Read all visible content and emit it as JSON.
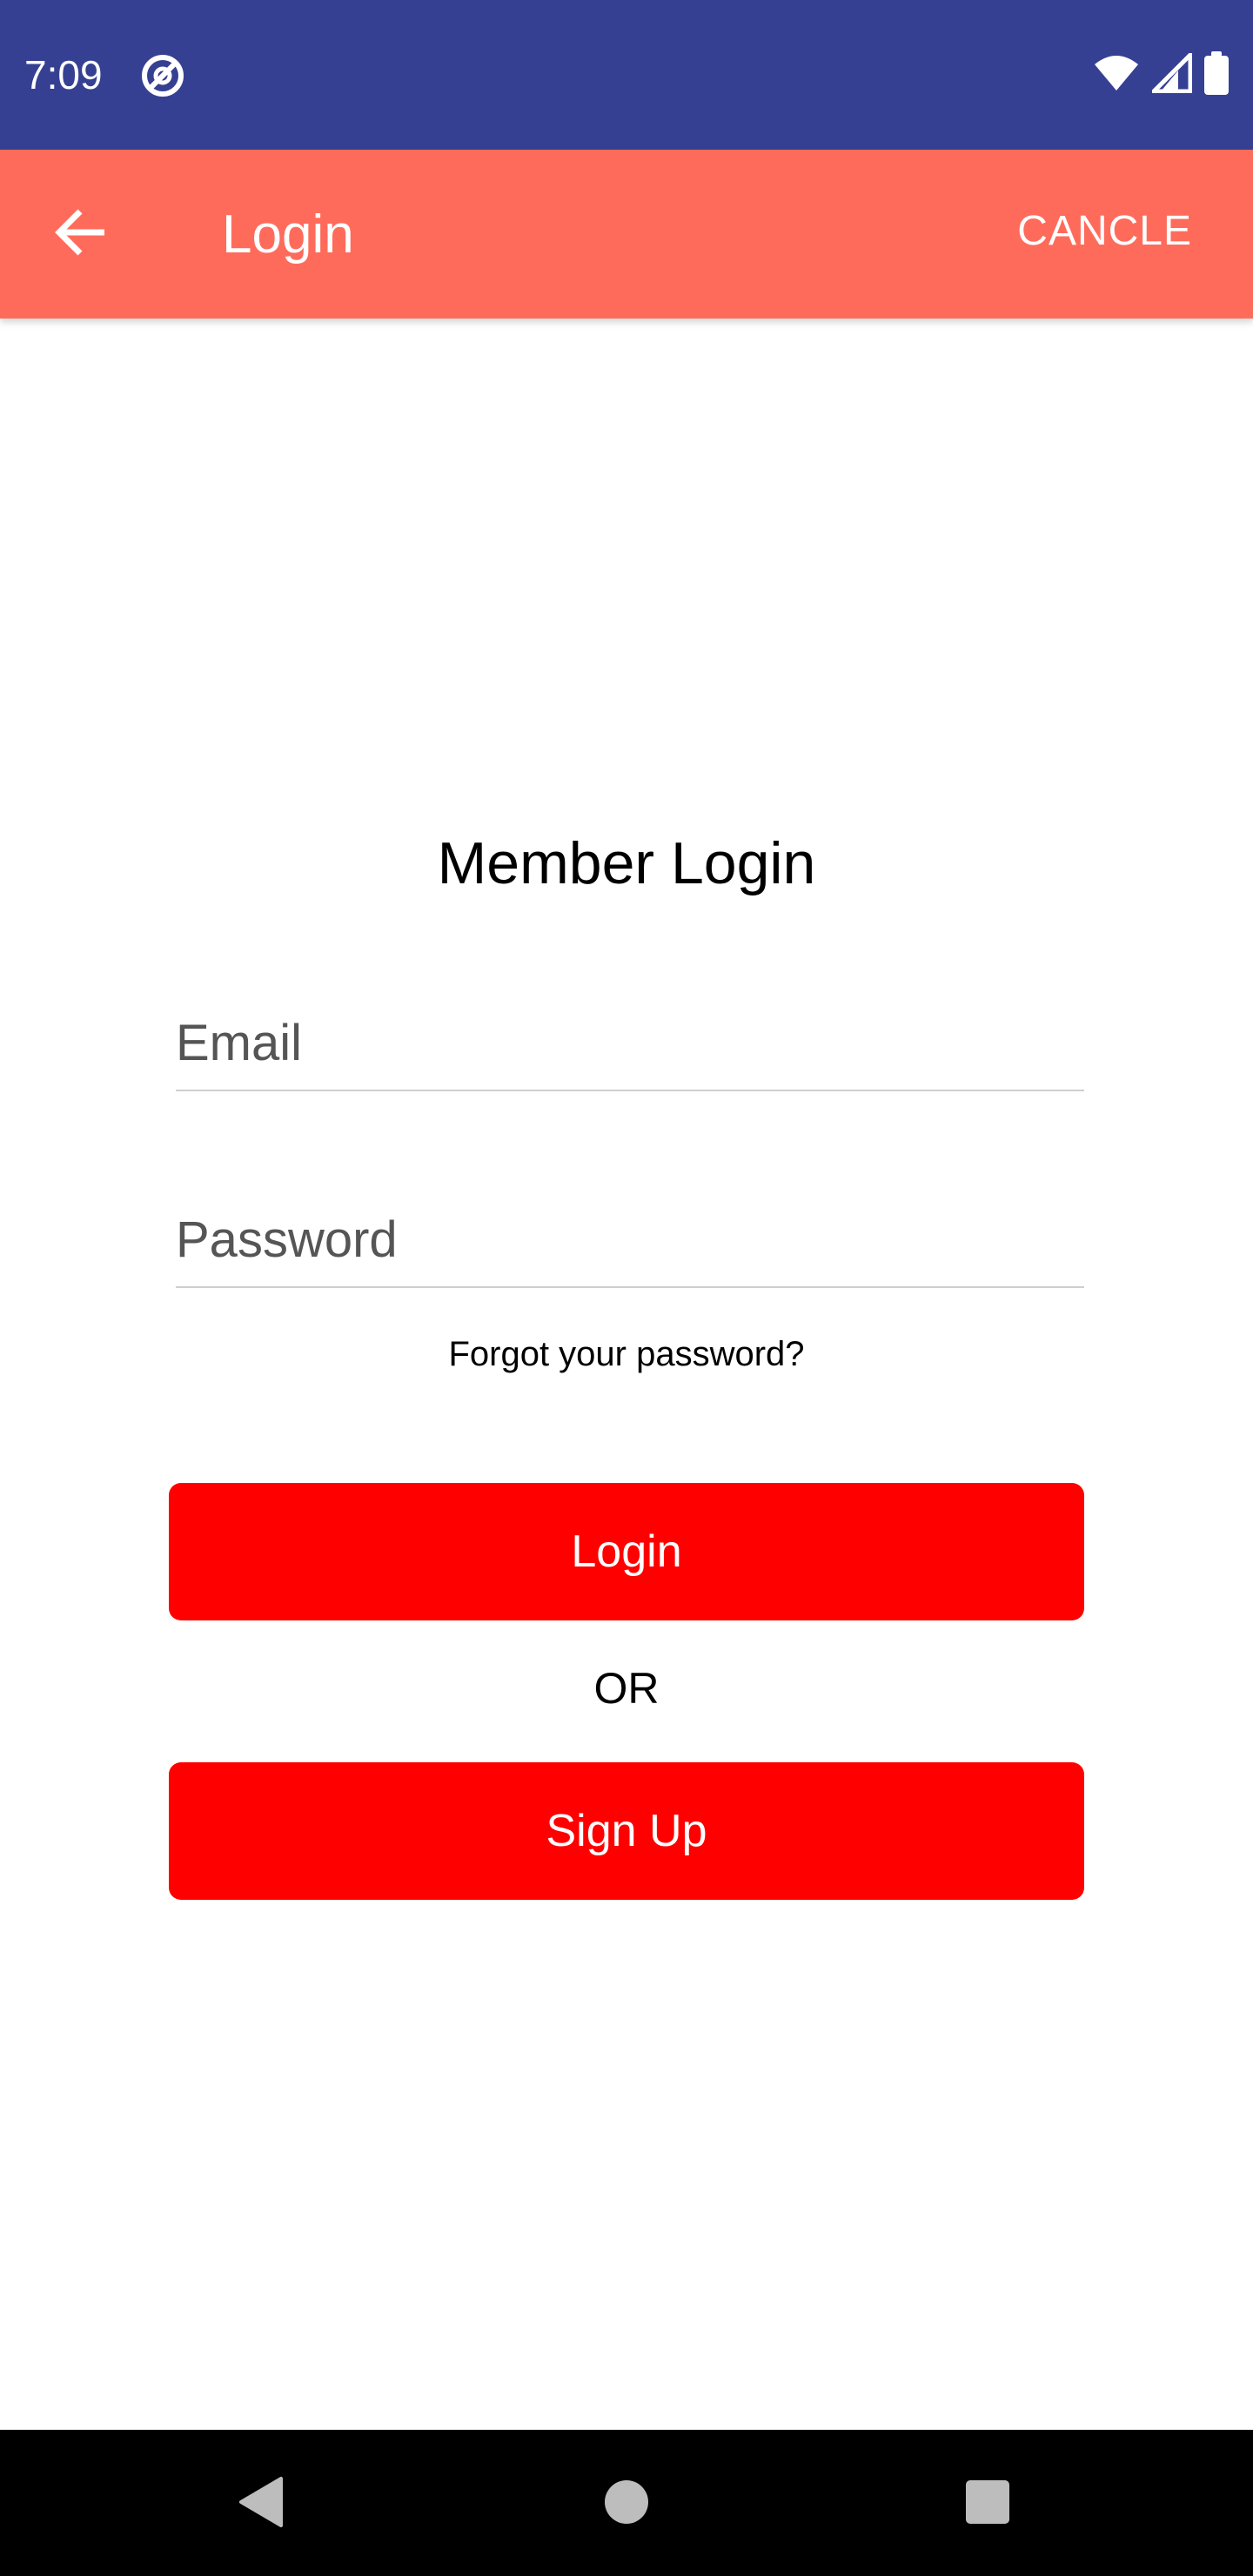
{
  "status_bar": {
    "time": "7:09",
    "icons": [
      "app-notification-icon",
      "wifi-icon",
      "cell-signal-icon",
      "battery-icon"
    ],
    "background": "#364092"
  },
  "app_bar": {
    "title": "Login",
    "action_label": "CANCLE",
    "back_icon": "arrow-left-icon",
    "background": "#ff6b5b"
  },
  "form": {
    "heading": "Member Login",
    "email_placeholder": "Email",
    "password_placeholder": "Password",
    "forgot_label": "Forgot your password?",
    "login_label": "Login",
    "or_label": "OR",
    "signup_label": "Sign Up",
    "button_color": "#ff0000"
  },
  "nav_bar": {
    "icons": [
      "back-triangle-icon",
      "home-circle-icon",
      "recents-square-icon"
    ]
  }
}
